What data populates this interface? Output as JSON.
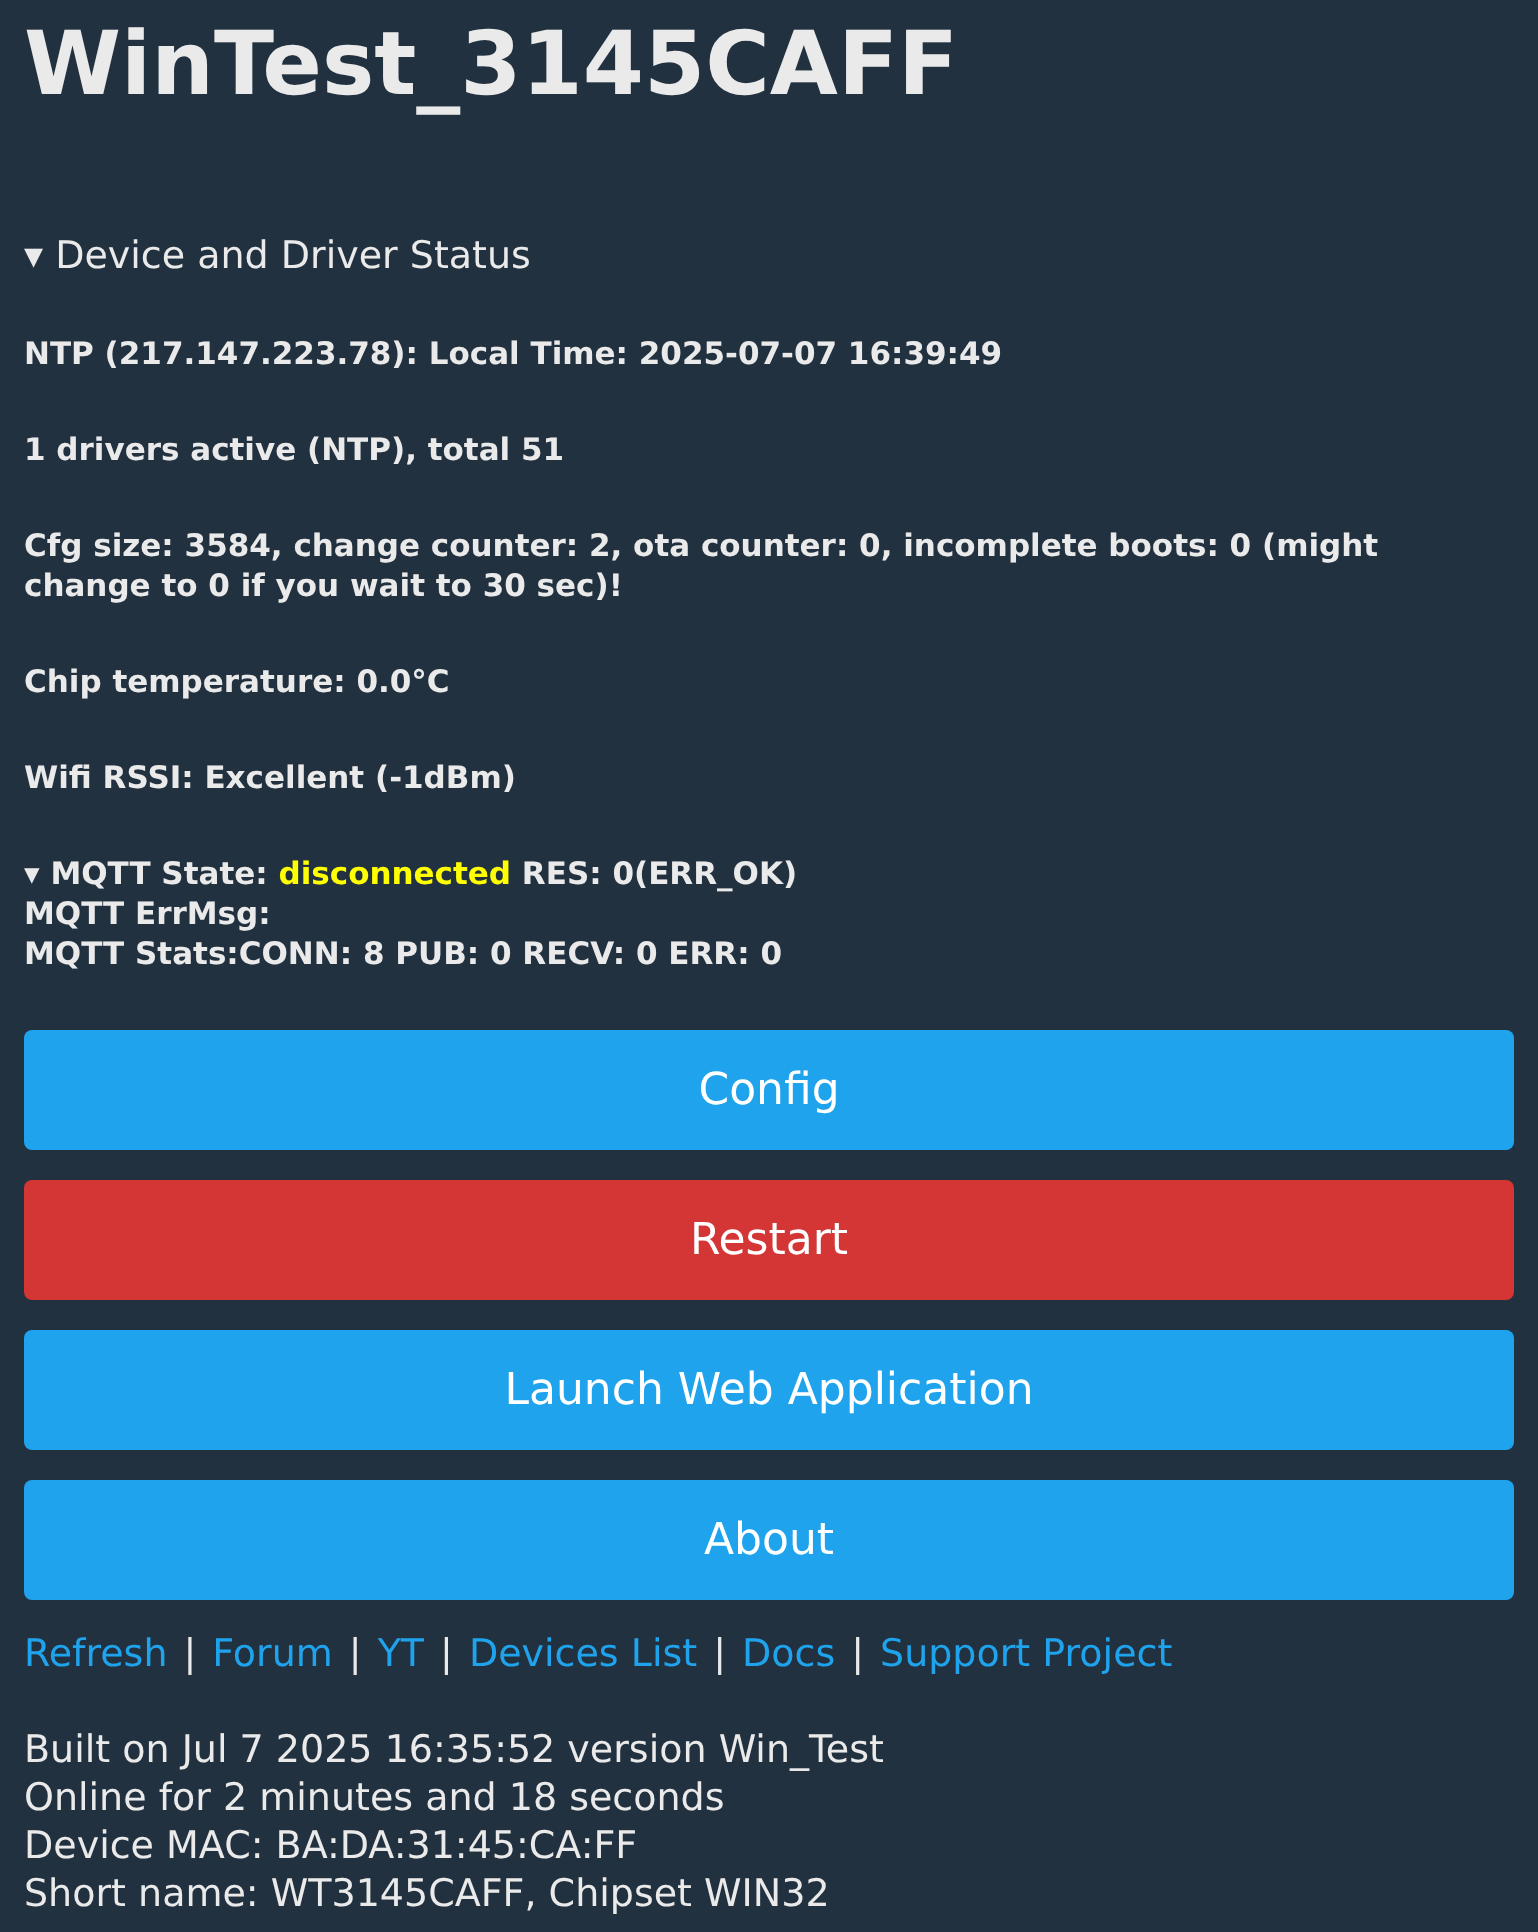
{
  "title": "WinTest_3145CAFF",
  "status": {
    "marker": "▾",
    "label": "Device and Driver Status",
    "expanded": true,
    "lines": [
      "NTP (217.147.223.78): Local Time: 2025-07-07 16:39:49",
      "1 drivers active (NTP), total 51",
      "Cfg size: 3584, change counter: 2, ota counter: 0, incomplete boots: 0 (might change to 0 if you wait to 30 sec)!",
      "Chip temperature: 0.0°C",
      "Wifi RSSI: Excellent (-1dBm)"
    ],
    "mqtt": {
      "marker": "▾",
      "label": "MQTT State:",
      "state": "disconnected",
      "color": "#ffff00",
      "result": "RES: 0(ERR_OK)",
      "lines": [
        "MQTT ErrMsg:",
        "MQTT Stats:CONN: 8 PUB: 0 RECV: 0 ERR: 0"
      ]
    }
  },
  "buttons": [
    {
      "label": "Config",
      "color": "#1fa3ec"
    },
    {
      "label": "Restart",
      "color": "#d43535"
    },
    {
      "label": "Launch Web Application",
      "color": "#1fa3ec"
    },
    {
      "label": "About",
      "color": "#1fa3ec"
    }
  ],
  "links": {
    "separator": "|",
    "items": [
      "Refresh",
      "Forum",
      "YT",
      "Devices List",
      "Docs",
      "Support Project"
    ]
  },
  "footer": [
    "Built on Jul 7 2025 16:35:52 version Win_Test",
    "Online for 2 minutes and 18 seconds",
    "Device MAC: BA:DA:31:45:CA:FF",
    "Short name: WT3145CAFF, Chipset WIN32"
  ]
}
